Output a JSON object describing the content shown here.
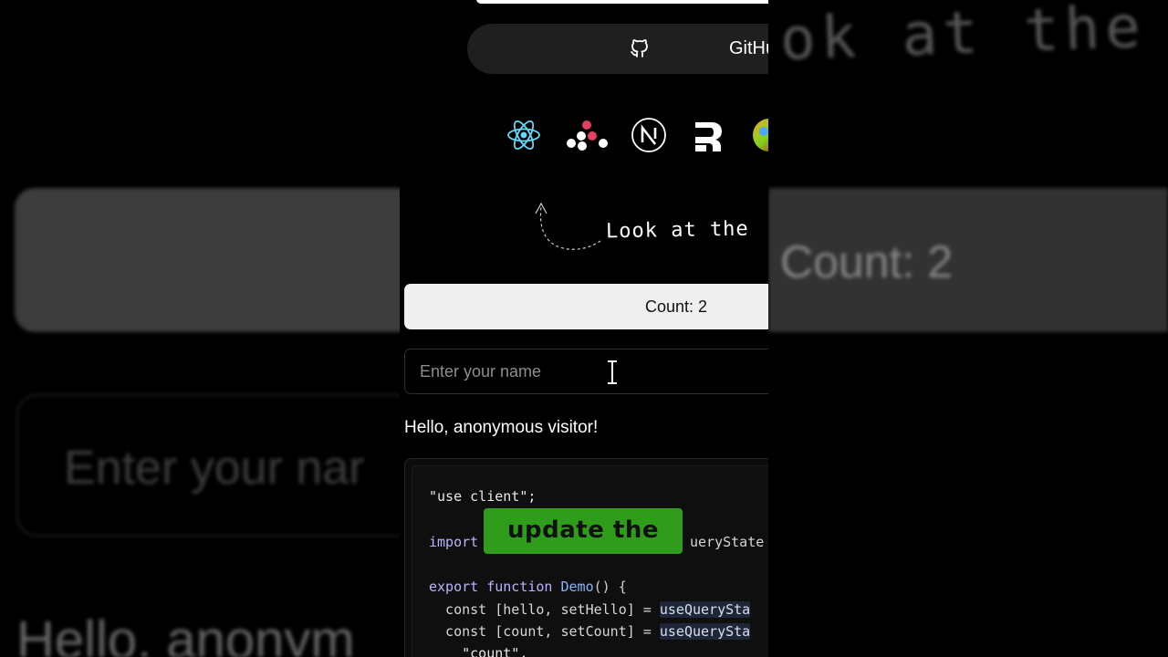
{
  "backdrop": {
    "hand_note": "ok at the",
    "count_text": "Count: 2",
    "input_text": "Enter your nar",
    "hello_text": "Hello, anonym"
  },
  "header": {
    "github_label": "GitHub"
  },
  "logos": [
    "react-logo",
    "tanstack-logo",
    "nextjs-logo",
    "remix-logo",
    "colorful-logo"
  ],
  "note": {
    "text": "Look at the"
  },
  "counter": {
    "label": "Count: 2"
  },
  "name_input": {
    "placeholder": "Enter your name",
    "value": ""
  },
  "greeting": {
    "text": "Hello, anonymous visitor!"
  },
  "code": {
    "line1": "\"use client\";",
    "line2_kw": "import",
    "line2_tail": "ueryState",
    "line3_kw": "export function",
    "line3_fn": "Demo",
    "line3_tail": "() {",
    "line4_a": "  const [hello, setHello] = ",
    "line4_b": "useQuerySta",
    "line5_a": "  const [count, setCount] = ",
    "line5_b": "useQuerySta",
    "line6": "    \"count\","
  },
  "caption": {
    "text": "update the"
  },
  "colors": {
    "caption_bg": "#2f9d1b",
    "count_bg": "#efefef",
    "background": "#000000"
  }
}
